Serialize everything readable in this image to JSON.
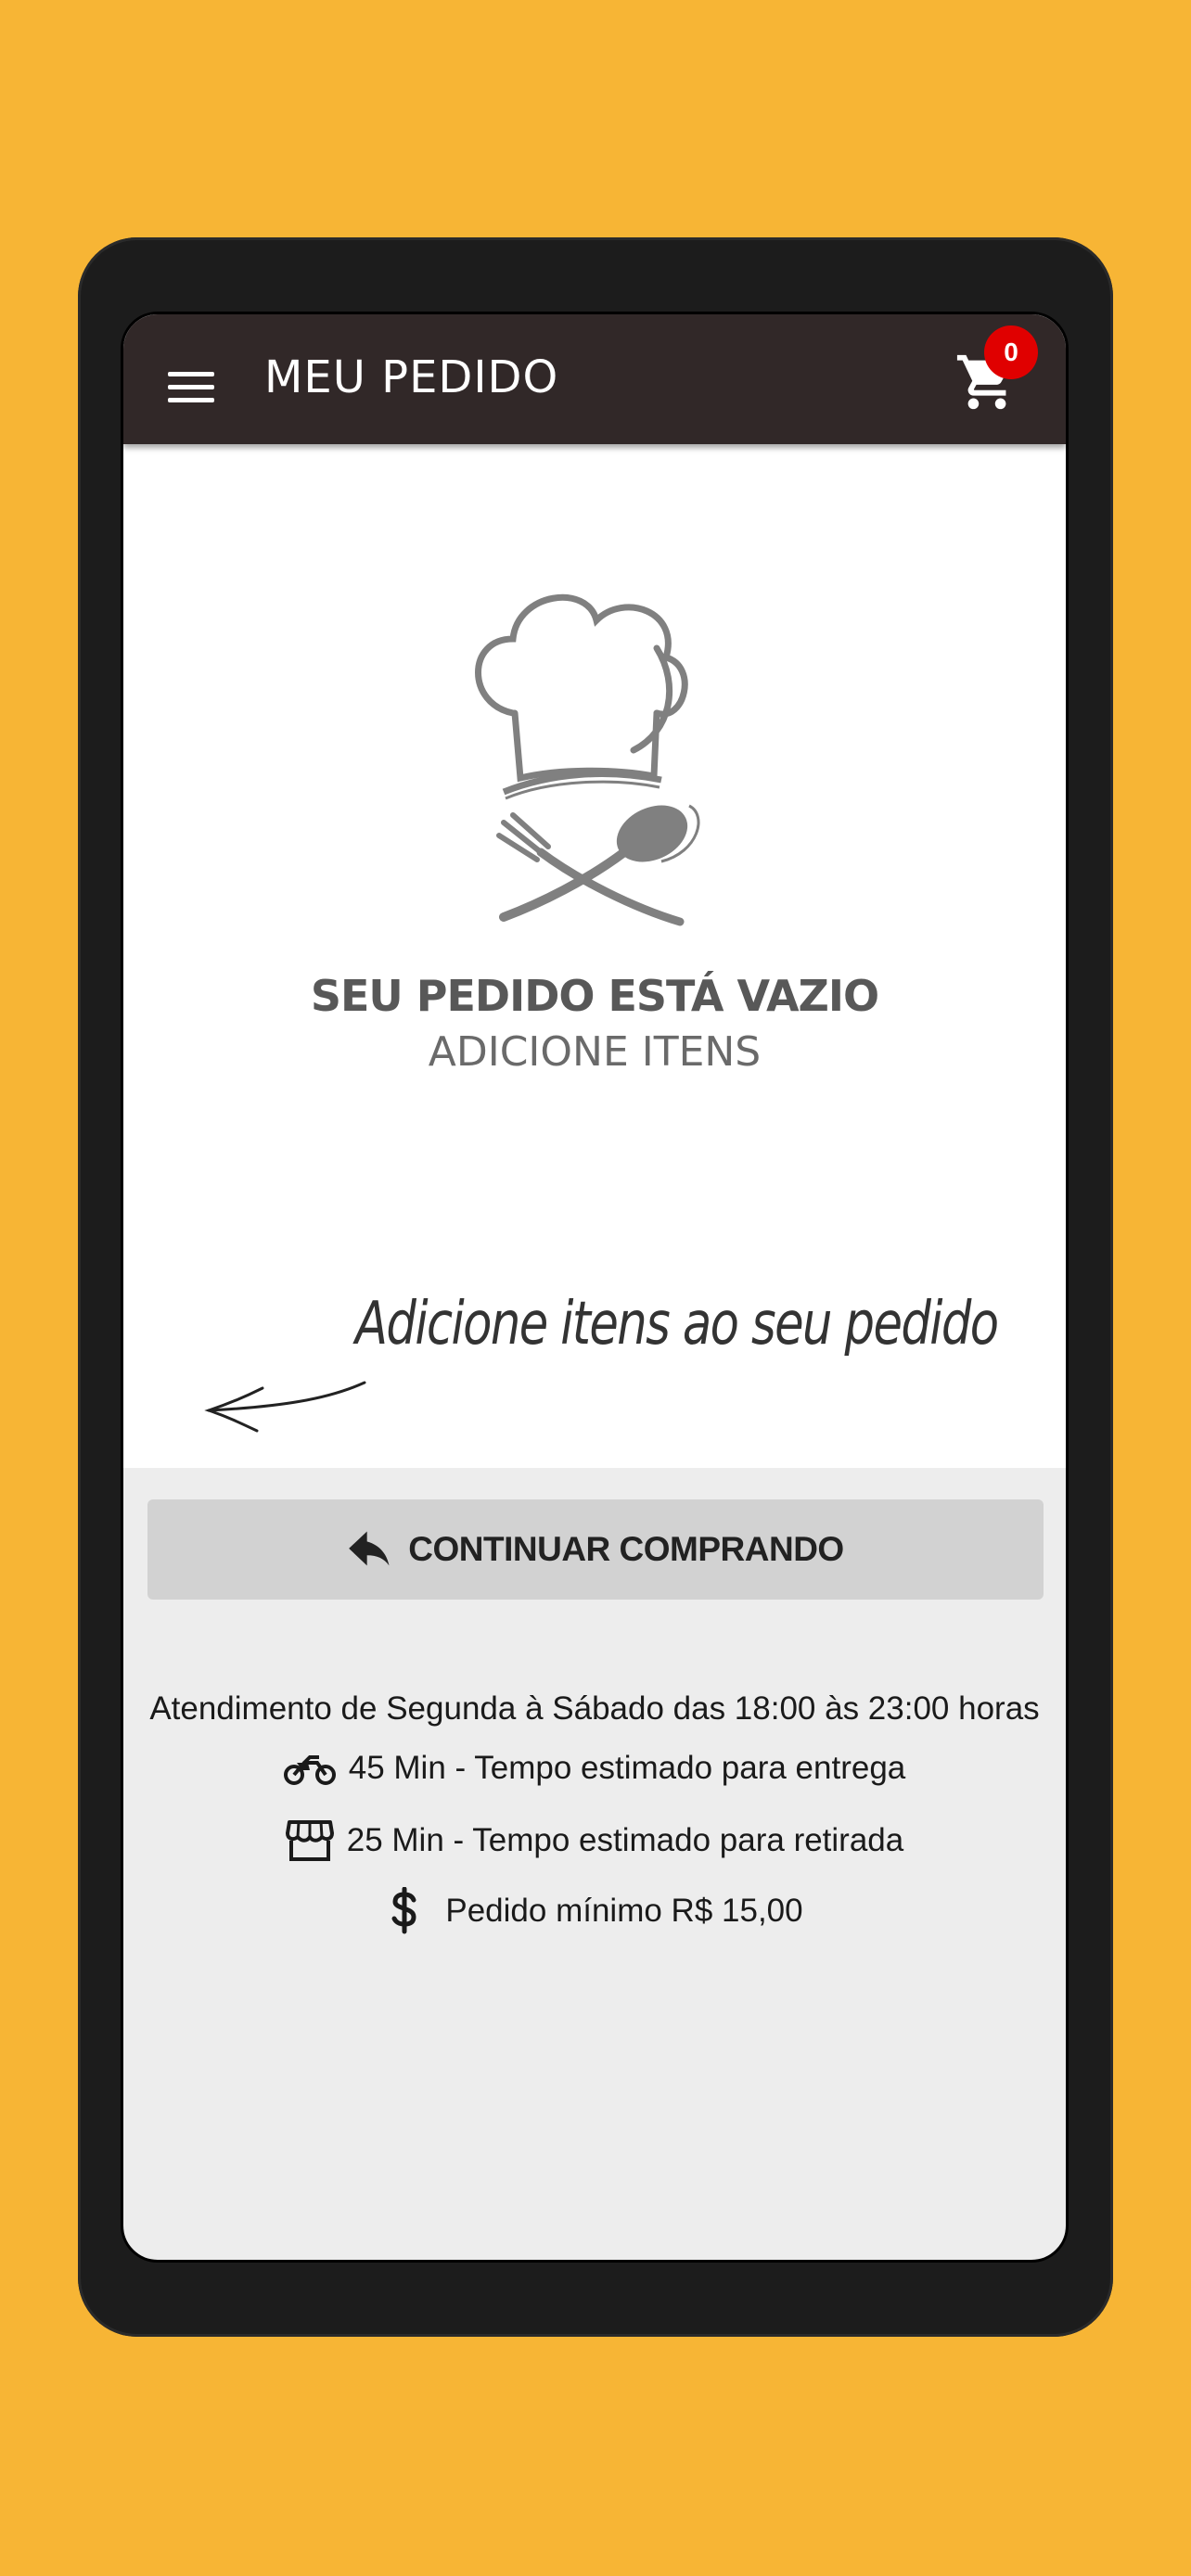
{
  "appbar": {
    "title": "MEU PEDIDO",
    "cart_count": "0"
  },
  "empty_state": {
    "title": "SEU PEDIDO ESTÁ VAZIO",
    "subtitle": "ADICIONE ITENS",
    "hint": "Adicione itens ao seu pedido"
  },
  "actions": {
    "continue_label": "CONTINUAR COMPRANDO"
  },
  "info": {
    "hours": "Atendimento de Segunda à Sábado das 18:00 às 23:00 horas",
    "delivery": "45 Min - Tempo estimado para entrega",
    "pickup": "25 Min - Tempo estimado para retirada",
    "minimum": "Pedido mínimo R$ 15,00"
  },
  "colors": {
    "background": "#F7B535",
    "appbar": "#312828",
    "badge": "#e00000",
    "button": "#d2d2d2"
  },
  "icons": [
    "menu-icon",
    "cart-icon",
    "reply-icon",
    "motorcycle-icon",
    "store-icon",
    "dollar-icon"
  ]
}
